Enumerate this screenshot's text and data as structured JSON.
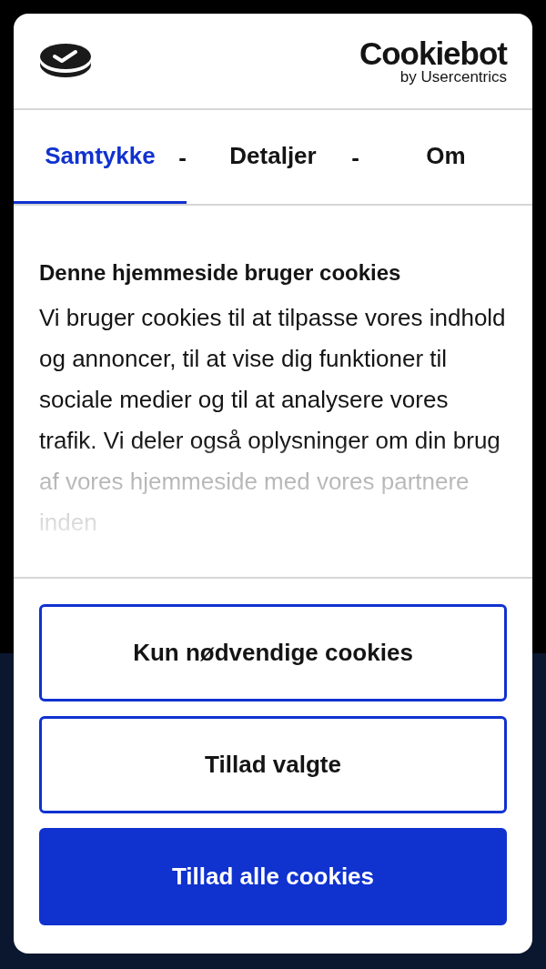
{
  "brand": {
    "name": "Cookiebot",
    "byline": "by Usercentrics"
  },
  "tabs": [
    {
      "label": "Samtykke",
      "selected": true,
      "separator": "-"
    },
    {
      "label": "Detaljer",
      "selected": false,
      "separator": "-"
    },
    {
      "label": "Om",
      "selected": false
    }
  ],
  "heading": "Denne hjemmeside bruger cookies",
  "body": "Vi bruger cookies til at tilpasse vores indhold og annoncer, til at vise dig funktioner til sociale medier og til at analysere vores trafik. Vi deler også oplysninger om din brug af vores hjemmeside med vores partnere inden",
  "buttons": [
    {
      "label": "Kun nødvendige cookies",
      "kind": "outline"
    },
    {
      "label": "Tillad valgte",
      "kind": "outline"
    },
    {
      "label": "Tillad alle cookies",
      "kind": "primary"
    }
  ]
}
